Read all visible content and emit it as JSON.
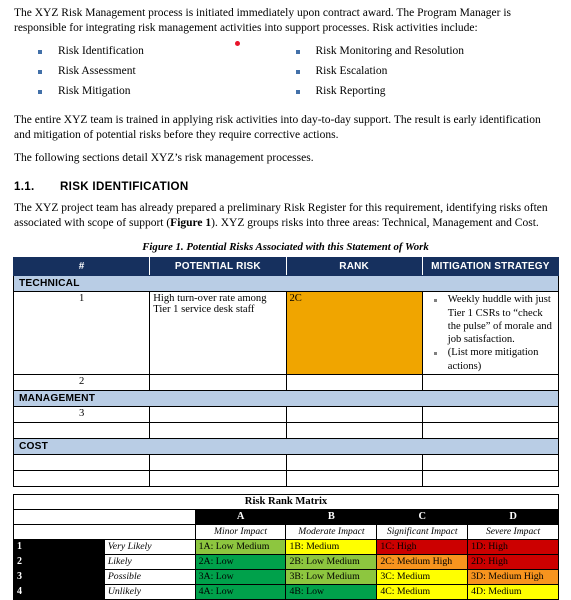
{
  "document": {
    "paragraphs": {
      "intro": "The XYZ Risk Management process is initiated immediately upon contract award. The Program Manager is responsible for integrating risk management activities into support processes. Risk activities include:",
      "team": "The entire XYZ team is trained in applying risk activities into day-to-day support. The result is early identification and mitigation of potential risks before they require corrective actions.",
      "sections_detail": "The following sections detail XYZ’s risk management processes.",
      "risk_register_pre": "The XYZ project team has already prepared a preliminary Risk Register for this requirement, identifying risks often associated with scope of support (",
      "risk_register_bold": "Figure 1",
      "risk_register_post": "). XYZ groups risks into three areas: Technical, Management and Cost."
    },
    "activities": {
      "left": [
        "Risk Identification",
        "Risk Assessment",
        "Risk Mitigation"
      ],
      "right": [
        "Risk Monitoring and Resolution",
        "Risk Escalation",
        "Risk Reporting"
      ]
    },
    "heading": {
      "number": "1.1.",
      "title": "RISK IDENTIFICATION"
    },
    "figure_caption": "Figure 1.  Potential Risks Associated with this Statement of Work"
  },
  "risk_table": {
    "headers": [
      "#",
      "POTENTIAL RISK",
      "RANK",
      "MITIGATION STRATEGY"
    ],
    "sections": [
      {
        "label": "TECHNICAL",
        "rows": [
          {
            "num": "1",
            "risk": "High turn-over rate among Tier 1 service desk staff",
            "rank": "2C",
            "rank_color": "#f0a500",
            "mitigations": [
              "Weekly huddle with just Tier 1 CSRs to “check the pulse” of morale and job satisfaction.",
              "(List more mitigation actions)"
            ]
          },
          {
            "num": "2",
            "risk": "",
            "rank": "",
            "mitigations": []
          }
        ]
      },
      {
        "label": "MANAGEMENT",
        "rows": [
          {
            "num": "3",
            "risk": "",
            "rank": "",
            "mitigations": []
          },
          {
            "num": "",
            "risk": "",
            "rank": "",
            "mitigations": []
          }
        ]
      },
      {
        "label": "COST",
        "rows": [
          {
            "num": "",
            "risk": "",
            "rank": "",
            "mitigations": []
          },
          {
            "num": "",
            "risk": "",
            "rank": "",
            "mitigations": []
          }
        ]
      }
    ]
  },
  "risk_matrix": {
    "title": "Risk Rank Matrix",
    "column_letters": [
      "A",
      "B",
      "C",
      "D"
    ],
    "column_impacts": [
      "Minor Impact",
      "Moderate Impact",
      "Significant Impact",
      "Severe Impact"
    ],
    "row_numbers": [
      "1",
      "2",
      "3",
      "4"
    ],
    "row_labels": [
      "Very Likely",
      "Likely",
      "Possible",
      "Unlikely"
    ],
    "cells": [
      [
        {
          "text": "1A: Low Medium",
          "color": "#8dc63f"
        },
        {
          "text": "1B: Medium",
          "color": "#ffff00"
        },
        {
          "text": "1C: High",
          "color": "#cc0000"
        },
        {
          "text": "1D: High",
          "color": "#cc0000"
        }
      ],
      [
        {
          "text": "2A: Low",
          "color": "#00a14b"
        },
        {
          "text": "2B: Low Medium",
          "color": "#8dc63f"
        },
        {
          "text": "2C: Medium High",
          "color": "#f7941e"
        },
        {
          "text": "2D: High",
          "color": "#cc0000"
        }
      ],
      [
        {
          "text": "3A: Low",
          "color": "#00a14b"
        },
        {
          "text": "3B: Low Medium",
          "color": "#8dc63f"
        },
        {
          "text": "3C: Medium",
          "color": "#ffff00"
        },
        {
          "text": "3D: Medium High",
          "color": "#f7941e"
        }
      ],
      [
        {
          "text": "4A: Low",
          "color": "#00a14b"
        },
        {
          "text": "4B: Low",
          "color": "#00a14b"
        },
        {
          "text": "4C: Medium",
          "color": "#ffff00"
        },
        {
          "text": "4D: Medium",
          "color": "#ffff00"
        }
      ]
    ]
  },
  "colors": {
    "header_navy": "#16305e",
    "section_blue": "#b9cde5",
    "bullet_blue": "#4270a8",
    "comment_dot_red": "#e8142a"
  }
}
